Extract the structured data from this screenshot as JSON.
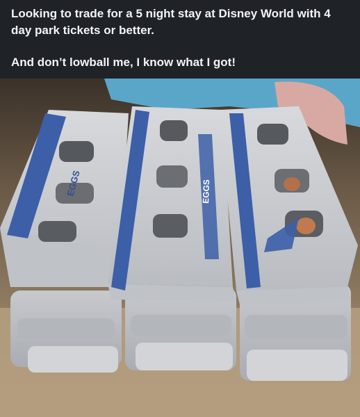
{
  "post": {
    "line1": "Looking to trade for a 5 night stay at Disney World with 4 day park tickets or better.",
    "line2": "And don’t lowball me, I know what I got!"
  },
  "photo": {
    "carton_label": "EGGS",
    "carton_colors": {
      "carton": "#c9ccd0",
      "stripe": "#3d5fa8",
      "table": "#b39c7e",
      "sleeve": "#5aa6c9",
      "glove": "#d9a9a3"
    }
  }
}
